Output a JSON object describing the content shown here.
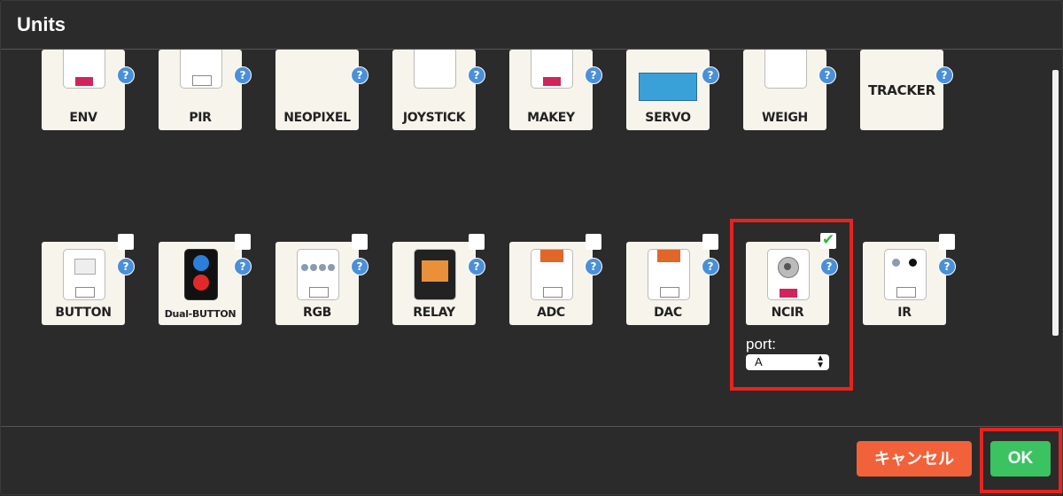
{
  "dialog": {
    "title": "Units"
  },
  "units_row1": [
    {
      "label": "ENV"
    },
    {
      "label": "PIR"
    },
    {
      "label": "NEOPIXEL"
    },
    {
      "label": "JOYSTICK"
    },
    {
      "label": "MAKEY"
    },
    {
      "label": "SERVO"
    },
    {
      "label": "WEIGH"
    },
    {
      "label": "TRACKER"
    }
  ],
  "units_row2": [
    {
      "label": "BUTTON",
      "checked": false
    },
    {
      "label": "Dual-BUTTON",
      "checked": false
    },
    {
      "label": "RGB",
      "checked": false
    },
    {
      "label": "RELAY",
      "checked": false
    },
    {
      "label": "ADC",
      "checked": false
    },
    {
      "label": "DAC",
      "checked": false
    },
    {
      "label": "NCIR",
      "checked": true
    },
    {
      "label": "IR",
      "checked": false
    }
  ],
  "help_glyph": "?",
  "ncir_port": {
    "label": "port:",
    "value": "A"
  },
  "footer": {
    "cancel_label": "キャンセル",
    "ok_label": "OK"
  },
  "colors": {
    "background": "#2b2b2b",
    "card": "#f7f4ec",
    "help": "#4a90d9",
    "cancel": "#f2623a",
    "ok": "#3bc261",
    "highlight": "#e8231f"
  }
}
